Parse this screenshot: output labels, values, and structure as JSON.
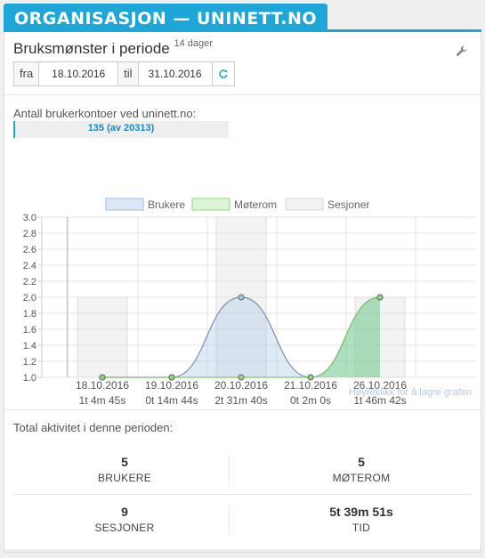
{
  "tab_title": "ORGANISASJON — UNINETT.NO",
  "header": {
    "title": "Bruksmønster i periode",
    "period_badge": "14 dager"
  },
  "date_range": {
    "from_label": "fra",
    "from_value": "18.10.2016",
    "to_label": "til",
    "to_value": "31.10.2016"
  },
  "accounts": {
    "label": "Antall brukerkontoer ved uninett.no:",
    "progress_text": "135 (av 20313)",
    "fraction": 0.0066
  },
  "chart_data": {
    "type": "line",
    "legend": [
      "Brukere",
      "Møterom",
      "Sesjoner"
    ],
    "categories": [
      "18.10.2016",
      "19.10.2016",
      "20.10.2016",
      "21.10.2016",
      "26.10.2016"
    ],
    "durations": [
      "1t 4m 45s",
      "0t 14m 44s",
      "2t 31m 40s",
      "0t 2m 0s",
      "1t 46m 42s"
    ],
    "series": [
      {
        "name": "Brukere",
        "values": [
          1,
          1,
          2,
          1,
          2
        ]
      },
      {
        "name": "Møterom",
        "values": [
          1,
          1,
          1,
          1,
          2
        ]
      },
      {
        "name": "Sesjoner",
        "values": [
          2,
          1,
          3,
          1,
          2
        ]
      }
    ],
    "ylim": [
      1.0,
      3.0
    ],
    "yticks": [
      "1.0",
      "1.2",
      "1.4",
      "1.6",
      "1.8",
      "2.0",
      "2.2",
      "2.4",
      "2.6",
      "2.8",
      "3.0"
    ],
    "colors": {
      "Brukere": "#9dbde6",
      "Møterom": "#8fd97a",
      "Sesjoner": "#d9d9d9"
    }
  },
  "save_hint": "Høyreklikk for å lagre grafen",
  "totals": {
    "label": "Total aktivitet i denne perioden:",
    "users_value": "5",
    "users_label": "BRUKERE",
    "rooms_value": "5",
    "rooms_label": "MØTEROM",
    "sessions_value": "9",
    "sessions_label": "SESJONER",
    "time_value": "5t 39m 51s",
    "time_label": "TID"
  }
}
